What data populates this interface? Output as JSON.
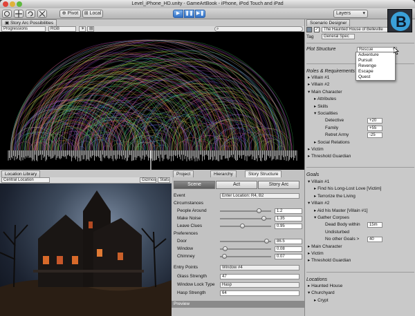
{
  "window": {
    "title": "Level_iPhone_HD.unity - GameArtBook - iPhone, iPod Touch and iPad"
  },
  "toolbar": {
    "pivot": "Pivot",
    "local": "Local",
    "layers": "Layers"
  },
  "story_arc": {
    "tab": "Story Arc Possibilities",
    "progressions": "Progressions",
    "rgb": "RGB",
    "search_icon": "search-icon"
  },
  "location_library": {
    "tab": "Location Library",
    "central_location": "Central Location",
    "gizmos": "Gizmos",
    "stats": "Stats"
  },
  "panel_tabs": {
    "project": "Project",
    "hierarchy": "Hierarchy",
    "story_structure": "Story Structure"
  },
  "segments": [
    "Scene",
    "Act",
    "Story Arc"
  ],
  "event": {
    "label": "Event",
    "value": "Enter Location: R4, B2"
  },
  "circumstances": {
    "header": "Circumstances",
    "rows": [
      {
        "label": "People Around",
        "value": "1.2",
        "level": 0.8
      },
      {
        "label": "Make Noise",
        "value": "1.35",
        "level": 0.9
      },
      {
        "label": "Leave Clues",
        "value": "0.95",
        "level": 0.45
      }
    ]
  },
  "preferences": {
    "header": "Preferences",
    "rows": [
      {
        "label": "Door",
        "value": "86.5",
        "level": 0.95
      },
      {
        "label": "Window",
        "value": "0.08",
        "level": 0.1
      },
      {
        "label": "Chimney",
        "value": "0.07",
        "level": 0.08
      }
    ]
  },
  "entry_points": {
    "label": "Entry Points",
    "value": "Window #4"
  },
  "glass_strength": {
    "label": "Glass Strength",
    "value": "47"
  },
  "window_lock": {
    "label": "Window Lock Type",
    "value": "Hasp"
  },
  "hasp_strength": {
    "label": "Hasp Strength",
    "value": "64"
  },
  "preview": "Preview",
  "designer": {
    "tab": "Scenario Designer",
    "object_name": "The Haunted House of Belleville",
    "tag_label": "Tag",
    "tag_value": "General Spec",
    "plot_label": "Plot Structure",
    "plot_value": "Rescue",
    "plot_options": [
      "Adventure",
      "Pursuit",
      "Revenge",
      "Escape",
      "Quest"
    ],
    "roles_header": "Roles & Requirements",
    "roles": [
      {
        "text": "Villain #1",
        "indent": 0,
        "arrow": "▸"
      },
      {
        "text": "Villain #2",
        "indent": 0,
        "arrow": "▸"
      },
      {
        "text": "Main Character",
        "indent": 0,
        "arrow": "▾"
      },
      {
        "text": "Attributes",
        "indent": 1,
        "arrow": "▸"
      },
      {
        "text": "Skills",
        "indent": 1,
        "arrow": "▸"
      },
      {
        "text": "Socialities",
        "indent": 1,
        "arrow": "▾"
      },
      {
        "text": "Detective",
        "indent": 2,
        "arrow": "",
        "value": "+20"
      },
      {
        "text": "Family",
        "indent": 2,
        "arrow": "",
        "value": "+55"
      },
      {
        "text": "Retret Army",
        "indent": 2,
        "arrow": "",
        "value": "-25"
      },
      {
        "text": "Social Relations",
        "indent": 1,
        "arrow": "▸"
      },
      {
        "text": "Victim",
        "indent": 0,
        "arrow": "▸"
      },
      {
        "text": "Threshold Guardian",
        "indent": 0,
        "arrow": "▸"
      }
    ],
    "goals_header": "Goals",
    "goals": [
      {
        "text": "Villain #1",
        "indent": 0,
        "arrow": "▾"
      },
      {
        "text": "Find his Long-Lost Love [Victim]",
        "indent": 1,
        "arrow": "▸"
      },
      {
        "text": "Terrorize the Living",
        "indent": 1,
        "arrow": "▸"
      },
      {
        "text": "Villain #2",
        "indent": 0,
        "arrow": "▾"
      },
      {
        "text": "Aid his Master [Villain #1]",
        "indent": 1,
        "arrow": "▸"
      },
      {
        "text": "Gather Corpses",
        "indent": 1,
        "arrow": "▾"
      },
      {
        "text": "Dead Body within",
        "indent": 2,
        "arrow": "",
        "value": "15m"
      },
      {
        "text": "Undisturbed",
        "indent": 2,
        "arrow": ""
      },
      {
        "text": "No other Goals >",
        "indent": 2,
        "arrow": "",
        "value": "40"
      },
      {
        "text": "Main Character",
        "indent": 0,
        "arrow": "▸"
      },
      {
        "text": "Victim",
        "indent": 0,
        "arrow": "▸"
      },
      {
        "text": "Threshold Guardian",
        "indent": 0,
        "arrow": "▸"
      }
    ],
    "locations_header": "Locations",
    "locations": [
      {
        "text": "Haunted House",
        "indent": 0,
        "arrow": "▸"
      },
      {
        "text": "Churchyard",
        "indent": 0,
        "arrow": "▾"
      },
      {
        "text": "Crypt",
        "indent": 1,
        "arrow": "▸"
      }
    ]
  },
  "logo": {
    "letter": "B"
  },
  "colors": {
    "accent": "#2f6fc4",
    "panel": "#c9c9c9",
    "graph_bg": "#000000"
  }
}
